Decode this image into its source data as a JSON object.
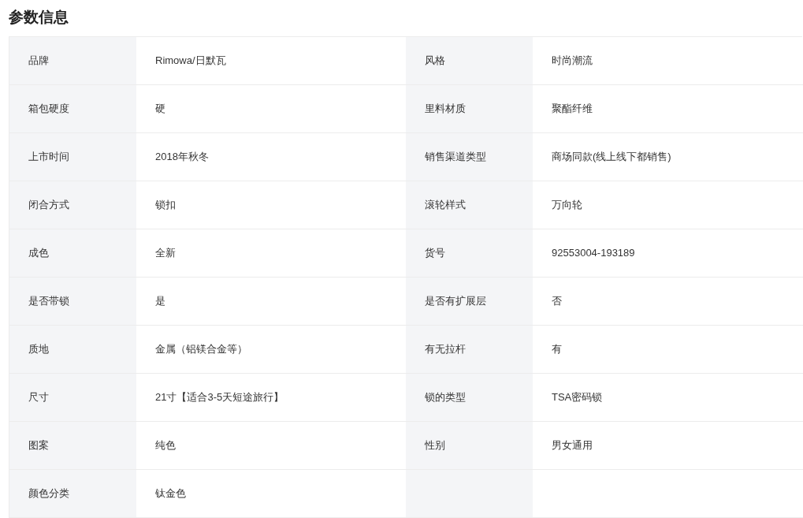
{
  "title": "参数信息",
  "params": [
    {
      "label": "品牌",
      "value": "Rimowa/日默瓦"
    },
    {
      "label": "风格",
      "value": "时尚潮流"
    },
    {
      "label": "箱包硬度",
      "value": "硬"
    },
    {
      "label": "里料材质",
      "value": "聚酯纤维"
    },
    {
      "label": "上市时间",
      "value": "2018年秋冬"
    },
    {
      "label": "销售渠道类型",
      "value": "商场同款(线上线下都销售)"
    },
    {
      "label": "闭合方式",
      "value": "锁扣"
    },
    {
      "label": "滚轮样式",
      "value": "万向轮"
    },
    {
      "label": "成色",
      "value": "全新"
    },
    {
      "label": "货号",
      "value": "92553004-193189"
    },
    {
      "label": "是否带锁",
      "value": "是"
    },
    {
      "label": "是否有扩展层",
      "value": "否"
    },
    {
      "label": "质地",
      "value": "金属（铝镁合金等）"
    },
    {
      "label": "有无拉杆",
      "value": "有"
    },
    {
      "label": "尺寸",
      "value": "21寸【适合3-5天短途旅行】"
    },
    {
      "label": "锁的类型",
      "value": "TSA密码锁"
    },
    {
      "label": "图案",
      "value": "纯色"
    },
    {
      "label": "性别",
      "value": "男女通用"
    },
    {
      "label": "颜色分类",
      "value": "钛金色"
    }
  ]
}
